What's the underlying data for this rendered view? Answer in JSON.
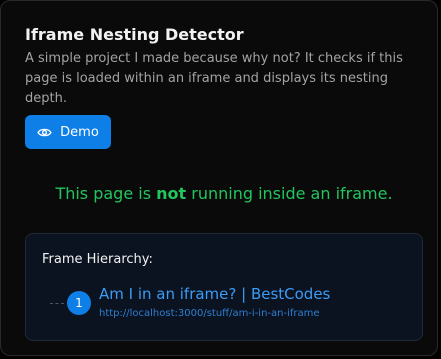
{
  "header": {
    "title": "Iframe Nesting Detector",
    "description": "A simple project I made because why not? It checks if this page is loaded within an iframe and displays its nesting depth."
  },
  "demo_button": {
    "label": "Demo",
    "icon": "eye-icon"
  },
  "status": {
    "prefix": "This page is ",
    "emphasis": "not",
    "suffix": " running inside an iframe.",
    "color": "#22c55e"
  },
  "hierarchy": {
    "title": "Frame Hierarchy:",
    "items": [
      {
        "index": "1",
        "title": "Am I in an iframe? | BestCodes",
        "url": "http://localhost:3000/stuff/am-i-in-an-iframe"
      }
    ]
  },
  "colors": {
    "accent": "#0e7fe6",
    "link": "#3b9cf5",
    "success": "#22c55e"
  }
}
